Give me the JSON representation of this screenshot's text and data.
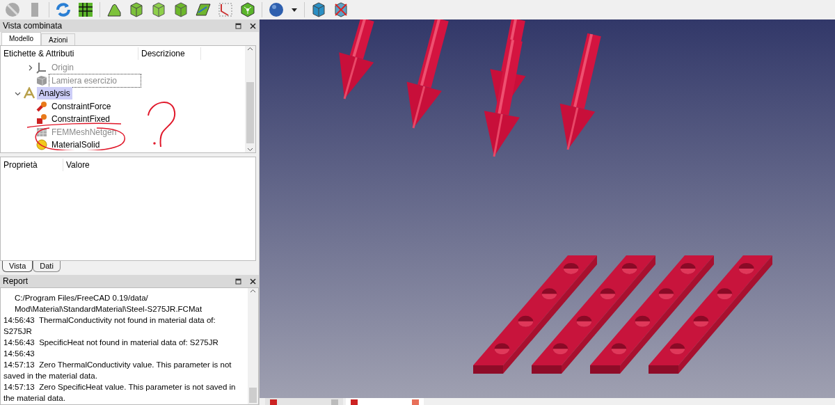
{
  "combo_view": {
    "title": "Vista combinata",
    "tabs": [
      {
        "label": "Modello",
        "selected": true
      },
      {
        "label": "Azioni",
        "selected": false
      }
    ],
    "tree_columns": [
      "Etichette & Attributi",
      "Descrizione"
    ],
    "tree_cut_branch": [
      {
        "label": "Origin",
        "kind": "origin",
        "expanded": false,
        "greyed": true,
        "focused": false
      },
      {
        "label": "Lamiera esercizio",
        "kind": "solid",
        "greyed": true,
        "focused": true
      }
    ],
    "tree": [
      {
        "label": "Analysis",
        "kind": "analysis",
        "expanded": true,
        "selected": true,
        "greyed": false,
        "children": [
          {
            "label": "ConstraintForce",
            "kind": "force",
            "selected": false,
            "greyed": false
          },
          {
            "label": "ConstraintFixed",
            "kind": "fixed",
            "selected": false,
            "greyed": false
          },
          {
            "label": "FEMMeshNetgen",
            "kind": "mesh",
            "selected": false,
            "greyed": true
          },
          {
            "label": "MaterialSolid",
            "kind": "material",
            "selected": false,
            "greyed": false
          }
        ]
      }
    ],
    "property_columns": [
      "Proprietà",
      "Valore"
    ],
    "bottom_tabs": [
      {
        "label": "Vista",
        "selected": true
      },
      {
        "label": "Dati",
        "selected": false
      }
    ]
  },
  "report": {
    "title": "Report",
    "lines": [
      {
        "kind": "continuation",
        "text": "C:/Program Files/FreeCAD 0.19/data/ Mod\\Material\\StandardMaterial\\Steel-S275JR.FCMat"
      },
      {
        "kind": "entry",
        "time": "14:56:43",
        "text": "ThermalConductivity not found in material data of: S275JR"
      },
      {
        "kind": "entry",
        "time": "14:56:43",
        "text": "SpecificHeat not found in material data of: S275JR"
      },
      {
        "kind": "entry",
        "time": "14:56:43"
      },
      {
        "kind": "entry",
        "time": "14:57:13",
        "text": "Zero ThermalConductivity value. This parameter is not saved in the material data."
      },
      {
        "kind": "entry",
        "time": "14:57:13",
        "text": "Zero SpecificHeat value. This parameter is not saved in the material data."
      }
    ]
  },
  "document_tabs": [
    {
      "selected": false
    },
    {
      "selected": true
    }
  ]
}
